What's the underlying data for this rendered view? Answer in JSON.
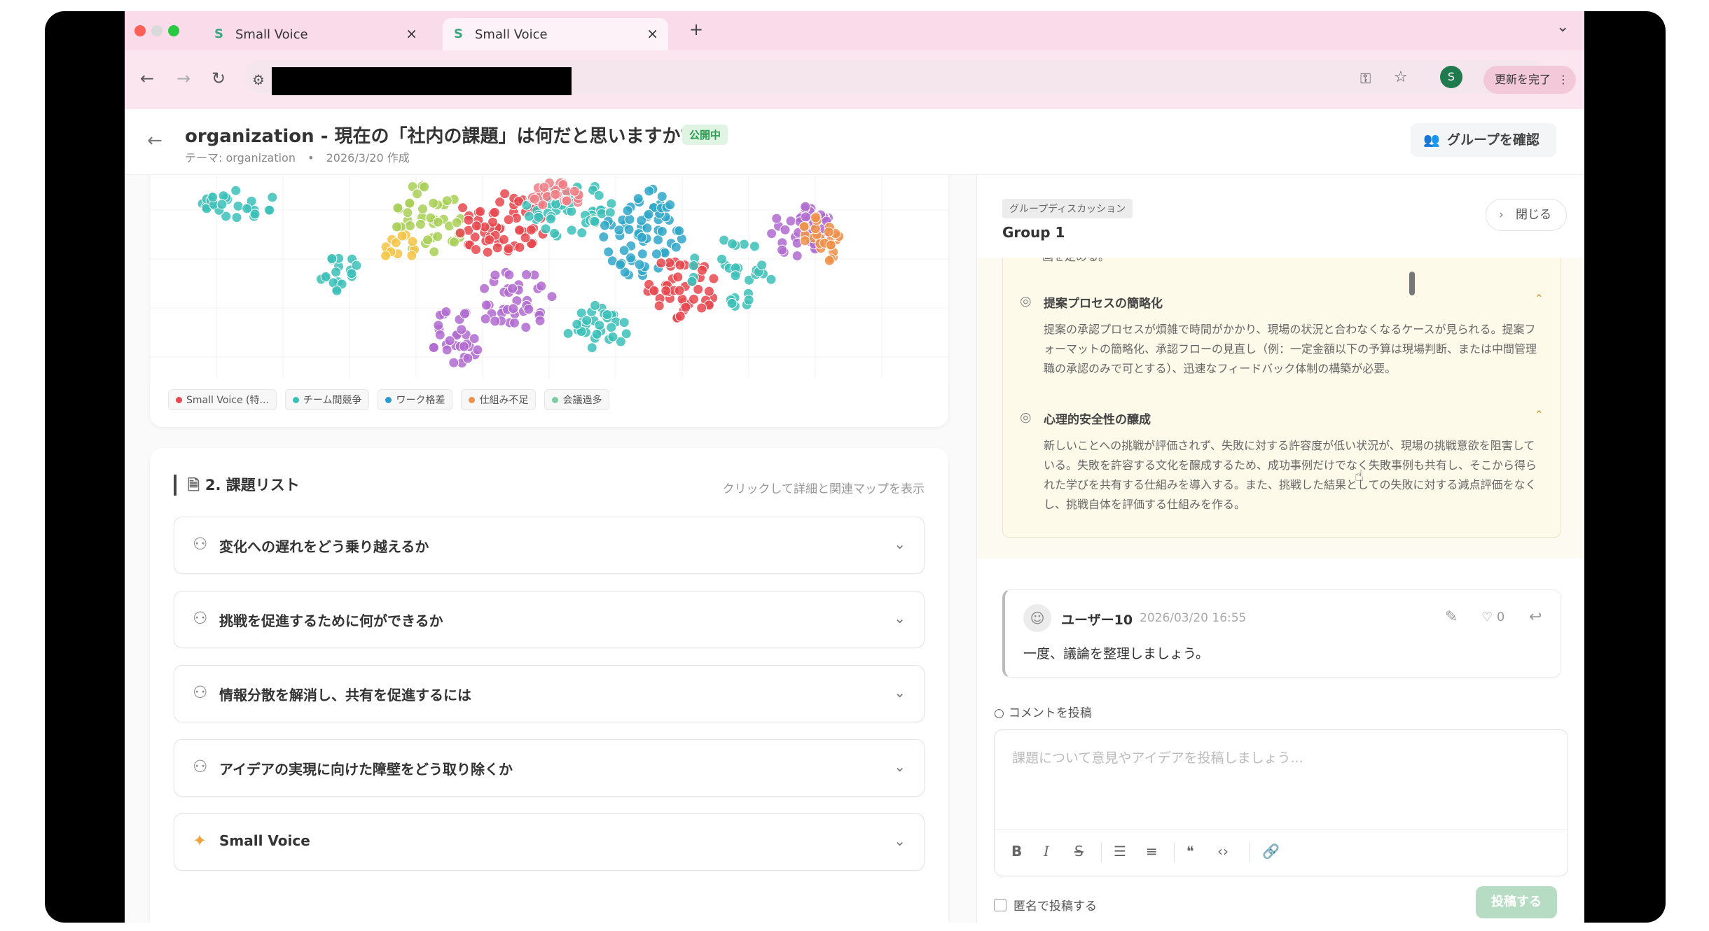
{
  "browser": {
    "tabs": [
      {
        "favicon": "S",
        "title": "Small Voice",
        "close": "×"
      },
      {
        "favicon": "S",
        "title": "Small Voice",
        "close": "×"
      }
    ],
    "new_tab": "+",
    "tab_menu": "⌄",
    "profile_initial": "S",
    "update_button": "更新を完了",
    "menu_dots": "⋮"
  },
  "header": {
    "back": "←",
    "title": "organization - 現在の「社内の課題」は何だと思いますか?",
    "status_badge": "公開中",
    "theme_label": "テーマ: organization",
    "separator": "•",
    "created": "2026/3/20 作成",
    "group_button": "グループを確認"
  },
  "map": {
    "legend": [
      {
        "label": "Small Voice (特...",
        "color": "#e8464e"
      },
      {
        "label": "チーム間競争",
        "color": "#3bbfb9"
      },
      {
        "label": "ワーク格差",
        "color": "#2a9bd0"
      },
      {
        "label": "仕組み不足",
        "color": "#f0904a"
      },
      {
        "label": "会議過多",
        "color": "#7ccba2"
      }
    ],
    "dot_colors": [
      "#3bbfb9",
      "#e8464e",
      "#b06bd0",
      "#f0904a",
      "#a9cf57",
      "#f6c343",
      "#2fa7c9",
      "#f07f86"
    ]
  },
  "issues": {
    "heading": "2. 課題リスト",
    "hint": "クリックして詳細と関連マップを表示",
    "items": [
      {
        "label": "変化への遅れをどう乗り越えるか"
      },
      {
        "label": "挑戦を促進するために何ができるか"
      },
      {
        "label": "情報分散を解消し、共有を促進するには"
      },
      {
        "label": "アイデアの実現に向けた障壁をどう取り除くか"
      },
      {
        "label": "Small Voice"
      }
    ]
  },
  "discussion": {
    "tag": "グループディスカッション",
    "title": "Group 1",
    "close_button": "閉じる",
    "cut_text": "画を定める。",
    "points": [
      {
        "title": "提案プロセスの簡略化",
        "body": "提案の承認プロセスが煩雑で時間がかかり、現場の状況と合わなくなるケースが見られる。提案フォーマットの簡略化、承認フローの見直し（例：一定金額以下の予算は現場判断、または中間管理職の承認のみで可とする）、迅速なフィードバック体制の構築が必要。"
      },
      {
        "title": "心理的安全性の醸成",
        "body": "新しいことへの挑戦が評価されず、失敗に対する許容度が低い状況が、現場の挑戦意欲を阻害している。失敗を許容する文化を醸成するため、成功事例だけでなく失敗事例も共有し、そこから得られた学びを共有する仕組みを導入する。また、挑戦した結果としての失敗に対する減点評価をなくし、挑戦自体を評価する仕組みを作る。"
      }
    ],
    "comment": {
      "user": "ユーザー10",
      "time": "2026/03/20 16:55",
      "body": "一度、議論を整理しましょう。",
      "likes": "0"
    },
    "post_label": "コメントを投稿",
    "placeholder": "課題について意見やアイデアを投稿しましょう...",
    "anonymous": "匿名で投稿する",
    "submit": "投稿する"
  }
}
